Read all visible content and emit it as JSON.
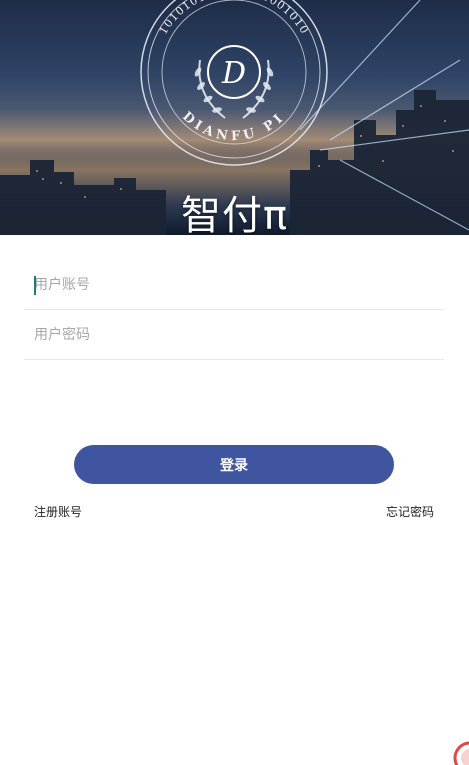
{
  "header": {
    "logo_text_top": "101010101001011001010",
    "logo_text_bottom": "DIANFU PI",
    "logo_letter": "D",
    "title": "智付π"
  },
  "form": {
    "account_placeholder": "用户账号",
    "password_placeholder": "用户密码",
    "login_label": "登录"
  },
  "links": {
    "register": "注册账号",
    "forgot": "忘记密码"
  },
  "colors": {
    "primary": "#3f55a0",
    "caret": "#1a7f7a",
    "divider": "#e8e8e8"
  }
}
